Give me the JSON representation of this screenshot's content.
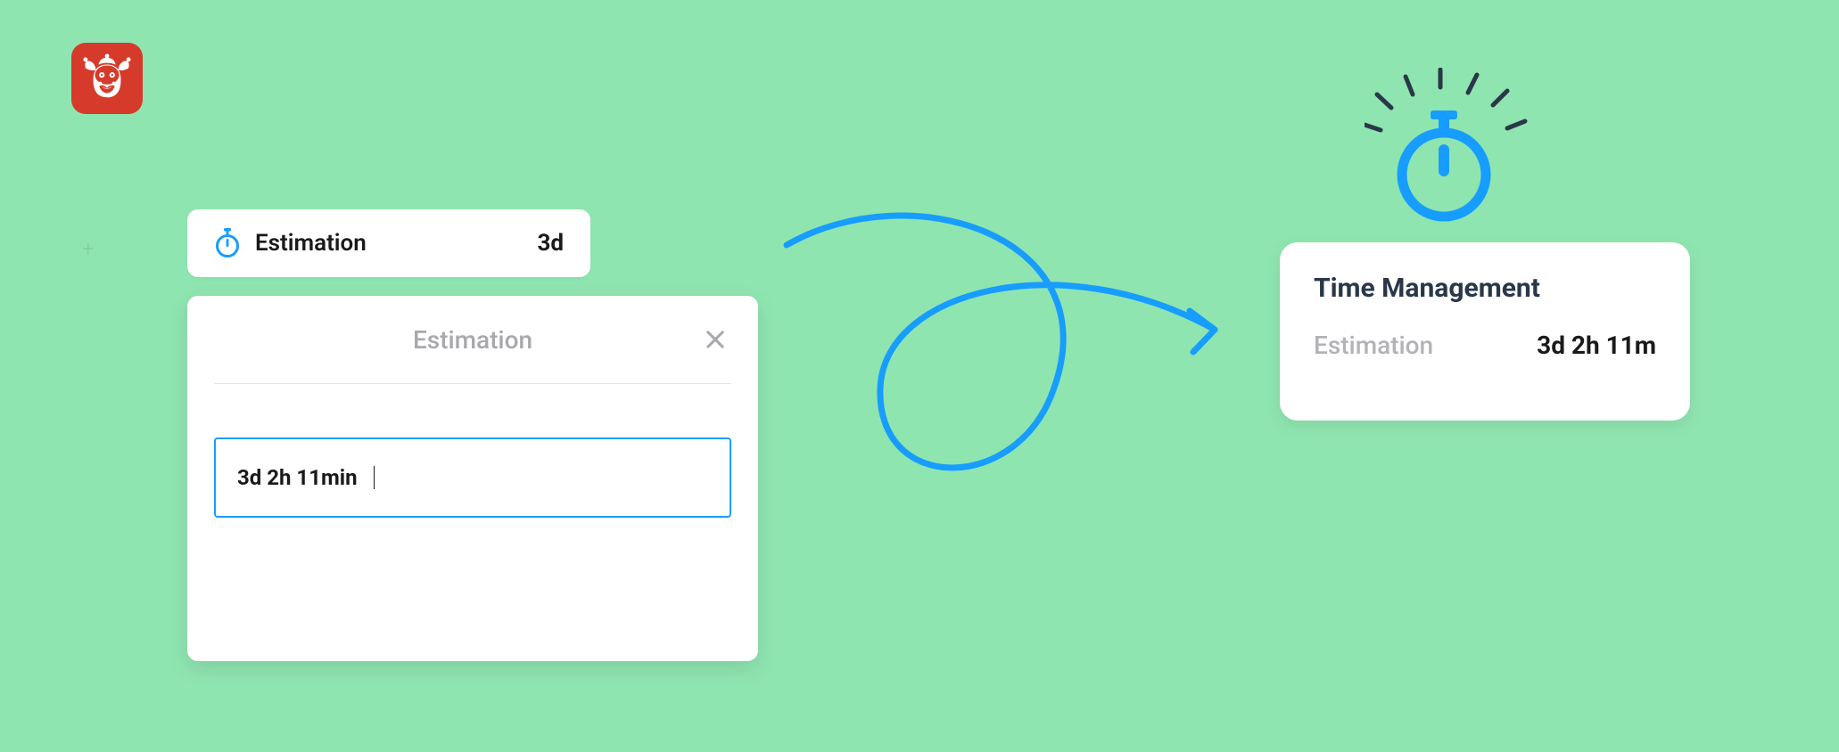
{
  "logo": {
    "name": "jester-app-logo"
  },
  "pill": {
    "label": "Estimation",
    "value": "3d"
  },
  "editor": {
    "title": "Estimation",
    "input_value": "3d 2h 11min"
  },
  "result_card": {
    "title": "Time Management",
    "label": "Estimation",
    "value": "3d 2h 11m"
  },
  "colors": {
    "accent_blue": "#179dff",
    "background": "#8fe5b0",
    "logo_bg": "#d63a2a"
  }
}
